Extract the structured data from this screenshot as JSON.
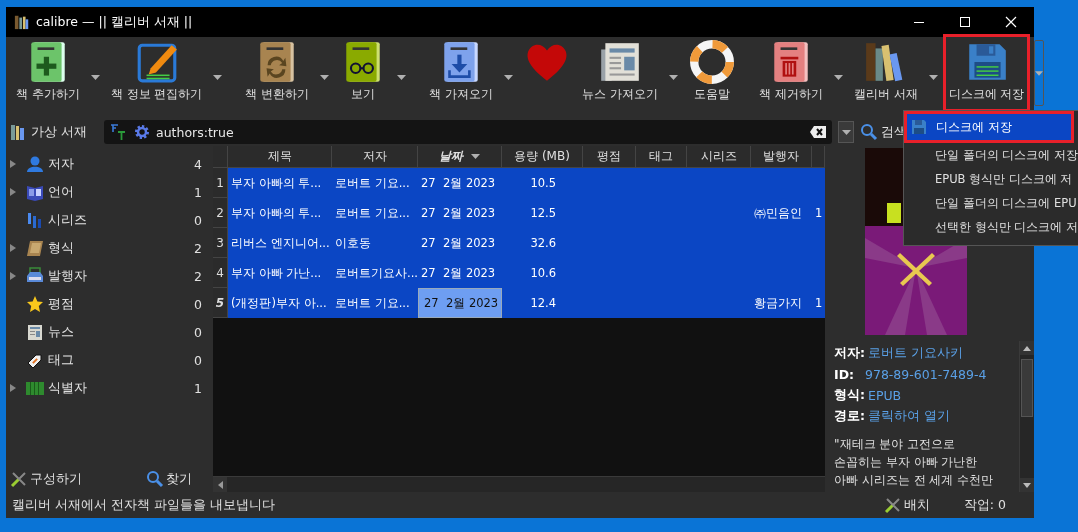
{
  "window": {
    "title": "calibre — || 캘리버 서재 ||"
  },
  "toolbar_groups": [
    [
      {
        "label": "책 추가하기",
        "dropdown": true,
        "highlighted": false
      },
      {
        "label": "책 정보 편집하기",
        "dropdown": true,
        "highlighted": false
      }
    ],
    [
      {
        "label": "책 변환하기",
        "dropdown": true,
        "highlighted": false
      },
      {
        "label": "보기",
        "dropdown": true,
        "highlighted": false
      }
    ],
    [
      {
        "label": "책 가져오기",
        "dropdown": true,
        "highlighted": false
      },
      {
        "dropdown": false,
        "highlighted": false
      },
      {
        "label": "뉴스 가져오기",
        "dropdown": true,
        "highlighted": false
      },
      {
        "label": "도움말",
        "dropdown": false,
        "highlighted": false
      }
    ],
    [
      {
        "label": "책 제거하기",
        "dropdown": true,
        "highlighted": false
      },
      {
        "label": "캘리버 서재",
        "dropdown": true,
        "highlighted": false
      },
      {
        "label": "디스크에 저장",
        "dropdown": true,
        "highlighted": true
      }
    ]
  ],
  "search_bar": {
    "virtual_library": "가상 서재",
    "query": "authors:true",
    "search_label": "검색"
  },
  "tag_browser": [
    {
      "label": "저자",
      "count": "4",
      "expandable": true
    },
    {
      "label": "언어",
      "count": "1",
      "expandable": true
    },
    {
      "label": "시리즈",
      "count": "0",
      "expandable": false
    },
    {
      "label": "형식",
      "count": "2",
      "expandable": true
    },
    {
      "label": "발행자",
      "count": "2",
      "expandable": true
    },
    {
      "label": "평점",
      "count": "0",
      "expandable": false
    },
    {
      "label": "뉴스",
      "count": "0",
      "expandable": false
    },
    {
      "label": "태그",
      "count": "0",
      "expandable": false
    },
    {
      "label": "식별자",
      "count": "1",
      "expandable": true
    }
  ],
  "tag_browser_actions": [
    "구성하기",
    "찾기"
  ],
  "book_list": {
    "columns": [
      {
        "label": "제목",
        "sorted": false
      },
      {
        "label": "저자",
        "sorted": false
      },
      {
        "label": "날짜",
        "sorted": true
      },
      {
        "label": "용량 (MB)",
        "sorted": false
      },
      {
        "label": "평점",
        "sorted": false
      },
      {
        "label": "태그",
        "sorted": false
      },
      {
        "label": "시리즈",
        "sorted": false
      },
      {
        "label": "발행자",
        "sorted": false
      }
    ],
    "rows": [
      {
        "number": "1",
        "selected": true,
        "current": false,
        "title": "부자 아빠의 투...",
        "author": "로버트 기요...",
        "date": "27  2월 2023",
        "size": "10.5"
      },
      {
        "number": "2",
        "selected": true,
        "current": false,
        "title": "부자 아빠의 투...",
        "author": "로버트 기요...",
        "date": "27  2월 2023",
        "size": "12.5",
        "publisher": "㈜민음인",
        "column_10": "1"
      },
      {
        "number": "3",
        "selected": true,
        "current": false,
        "title": "리버스 엔지니어...",
        "author": "이호동",
        "date": "27  2월 2023",
        "size": "32.6"
      },
      {
        "number": "4",
        "selected": true,
        "current": false,
        "title": "부자 아빠 가난...",
        "author": "로버트기요사...",
        "date": "27  2월 2023",
        "size": "10.6"
      },
      {
        "number": "5",
        "selected": true,
        "current": true,
        "title": "(개정판)부자 아...",
        "author": "로버트 기요...",
        "date": "27  2월 2023",
        "size": "12.4",
        "publisher": "황금가지",
        "column_10": "1"
      }
    ]
  },
  "book_details": {
    "cover": {
      "kind": "picture"
    },
    "fields": [
      {
        "label": "저자:",
        "value": "로버트 기요사키"
      },
      {
        "label": "ID:",
        "value": "978-89-601-7489-4"
      },
      {
        "label": "형식:",
        "value": "EPUB"
      },
      {
        "label": "경로:",
        "value": "클릭하여 열기"
      }
    ],
    "description": [
      "\"재테크 분야 고전으로",
      "손꼽히는 부자 아빠 가난한",
      "아빠 시리즈는 전 세계 수천만"
    ]
  },
  "context_menu": [
    {
      "label": "디스크에 저장",
      "selected": true,
      "highlighted": true
    },
    {
      "label": "단일 폴더의 디스크에 저장",
      "selected": false,
      "highlighted": false
    },
    {
      "label": "EPUB 형식만 디스크에 저",
      "selected": false,
      "highlighted": false
    },
    {
      "label": "단일 폴더의 디스크에 EPU",
      "selected": false,
      "highlighted": false
    },
    {
      "label": "선택한 형식만 디스크에 저",
      "selected": false,
      "highlighted": false
    }
  ],
  "status_bar": {
    "message": "캘리버 서재에서 전자책 파일들을 내보냅니다",
    "jobs_button": "배치",
    "jobs": "작업: 0"
  }
}
